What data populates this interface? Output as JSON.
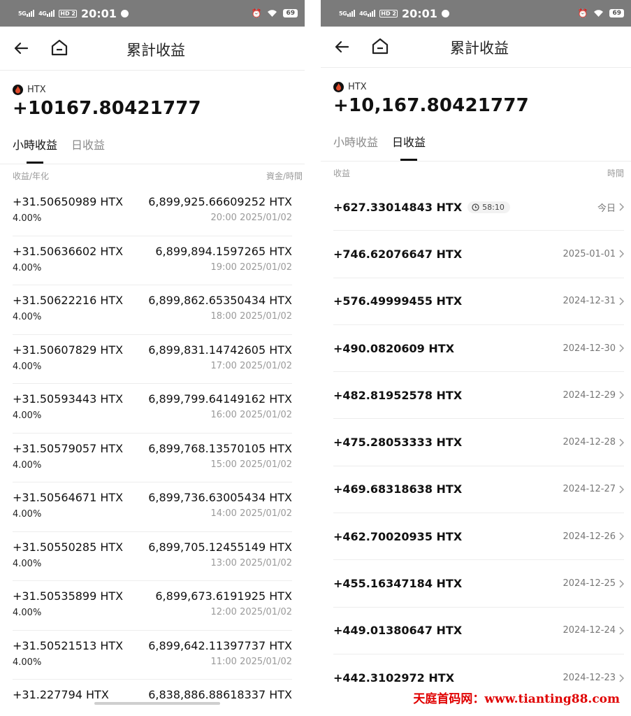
{
  "left": {
    "status": {
      "time": "20:01",
      "net1": "5G",
      "net2": "4G",
      "hd": "HD 2",
      "battery": "69"
    },
    "title": "累計收益",
    "coin": "HTX",
    "total": "+10167.80421777",
    "tabs": [
      {
        "label": "小時收益",
        "active": true
      },
      {
        "label": "日收益",
        "active": false
      }
    ],
    "col_left": "收益/年化",
    "col_right": "資金/時間",
    "rows": [
      {
        "amount": "+31.50650989 HTX",
        "apr": "4.00%",
        "fund": "6,899,925.66609252 HTX",
        "time": "20:00 2025/01/02"
      },
      {
        "amount": "+31.50636602 HTX",
        "apr": "4.00%",
        "fund": "6,899,894.1597265 HTX",
        "time": "19:00 2025/01/02"
      },
      {
        "amount": "+31.50622216 HTX",
        "apr": "4.00%",
        "fund": "6,899,862.65350434 HTX",
        "time": "18:00 2025/01/02"
      },
      {
        "amount": "+31.50607829 HTX",
        "apr": "4.00%",
        "fund": "6,899,831.14742605 HTX",
        "time": "17:00 2025/01/02"
      },
      {
        "amount": "+31.50593443 HTX",
        "apr": "4.00%",
        "fund": "6,899,799.64149162 HTX",
        "time": "16:00 2025/01/02"
      },
      {
        "amount": "+31.50579057 HTX",
        "apr": "4.00%",
        "fund": "6,899,768.13570105 HTX",
        "time": "15:00 2025/01/02"
      },
      {
        "amount": "+31.50564671 HTX",
        "apr": "4.00%",
        "fund": "6,899,736.63005434 HTX",
        "time": "14:00 2025/01/02"
      },
      {
        "amount": "+31.50550285 HTX",
        "apr": "4.00%",
        "fund": "6,899,705.12455149 HTX",
        "time": "13:00 2025/01/02"
      },
      {
        "amount": "+31.50535899 HTX",
        "apr": "4.00%",
        "fund": "6,899,673.6191925 HTX",
        "time": "12:00 2025/01/02"
      },
      {
        "amount": "+31.50521513 HTX",
        "apr": "4.00%",
        "fund": "6,899,642.11397737 HTX",
        "time": "11:00 2025/01/02"
      },
      {
        "amount": "+31.227794 HTX",
        "apr": "",
        "fund": "6,838,886.88618337 HTX",
        "time": ""
      }
    ]
  },
  "right": {
    "status": {
      "time": "20:01",
      "net1": "5G",
      "net2": "4G",
      "hd": "HD 2",
      "battery": "69"
    },
    "title": "累計收益",
    "coin": "HTX",
    "total": "+10,167.80421777",
    "tabs": [
      {
        "label": "小時收益",
        "active": false
      },
      {
        "label": "日收益",
        "active": true
      }
    ],
    "col_left": "收益",
    "col_right": "時間",
    "rows": [
      {
        "amount": "+627.33014843 HTX",
        "date": "今日",
        "countdown": "58:10"
      },
      {
        "amount": "+746.62076647 HTX",
        "date": "2025-01-01"
      },
      {
        "amount": "+576.49999455 HTX",
        "date": "2024-12-31"
      },
      {
        "amount": "+490.0820609 HTX",
        "date": "2024-12-30"
      },
      {
        "amount": "+482.81952578 HTX",
        "date": "2024-12-29"
      },
      {
        "amount": "+475.28053333 HTX",
        "date": "2024-12-28"
      },
      {
        "amount": "+469.68318638 HTX",
        "date": "2024-12-27"
      },
      {
        "amount": "+462.70020935 HTX",
        "date": "2024-12-26"
      },
      {
        "amount": "+455.16347184 HTX",
        "date": "2024-12-25"
      },
      {
        "amount": "+449.01380647 HTX",
        "date": "2024-12-24"
      },
      {
        "amount": "+442.3102972 HTX",
        "date": "2024-12-23"
      }
    ]
  },
  "watermark": "天庭首码网：www.tianting88.com"
}
